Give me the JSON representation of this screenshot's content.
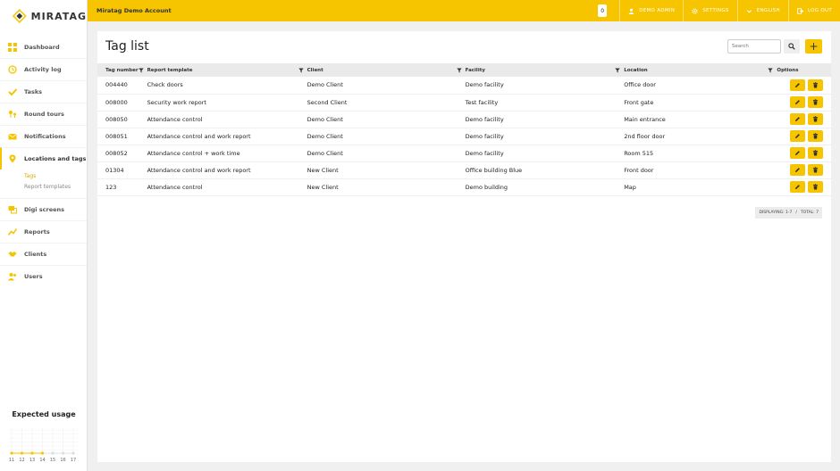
{
  "brand": {
    "name": "MIRATAG",
    "accent": "#f7c500"
  },
  "sidebar": {
    "items": [
      {
        "label": "Dashboard",
        "icon": "grid-icon"
      },
      {
        "label": "Activity log",
        "icon": "history-icon"
      },
      {
        "label": "Tasks",
        "icon": "check-icon"
      },
      {
        "label": "Round tours",
        "icon": "route-pins-icon"
      },
      {
        "label": "Notifications",
        "icon": "envelope-icon"
      },
      {
        "label": "Locations and tags",
        "icon": "pin-icon",
        "active": true
      },
      {
        "label": "Digi screens",
        "icon": "screens-icon"
      },
      {
        "label": "Reports",
        "icon": "chart-line-icon"
      },
      {
        "label": "Clients",
        "icon": "handshake-icon"
      },
      {
        "label": "Users",
        "icon": "users-icon"
      }
    ],
    "subitems": [
      {
        "label": "Tags",
        "selected": true
      },
      {
        "label": "Report templates"
      }
    ]
  },
  "usage": {
    "title": "Expected usage",
    "labels": [
      "11",
      "12",
      "13",
      "14",
      "15",
      "16",
      "17"
    ],
    "active_count": 4
  },
  "topbar": {
    "account": "Miratag Demo Account",
    "badge": "0",
    "user": "Demo admin",
    "settings": "Settings",
    "language": "English",
    "logout": "Log out"
  },
  "page": {
    "title": "Tag list",
    "search_placeholder": "Search",
    "add_label": "+"
  },
  "table": {
    "headers": [
      "Tag number",
      "Report template",
      "Client",
      "Facility",
      "Location",
      "Options"
    ],
    "rows": [
      [
        "004440",
        "Check doors",
        "Demo Client",
        "Demo facility",
        "Office door"
      ],
      [
        "008000",
        "Security work report",
        "Second Client",
        "Test facility",
        "Front gate"
      ],
      [
        "008050",
        "Attendance control",
        "Demo Client",
        "Demo facility",
        "Main entrance"
      ],
      [
        "008051",
        "Attendance control and work report",
        "Demo Client",
        "Demo facility",
        "2nd floor door"
      ],
      [
        "008052",
        "Attendance control + work time",
        "Demo Client",
        "Demo facility",
        "Room 515"
      ],
      [
        "01304",
        "Attendance control and work report",
        "New Client",
        "Office building Blue",
        "Front door"
      ],
      [
        "123",
        "Attendance control",
        "New Client",
        "Demo building",
        "Map"
      ]
    ]
  },
  "pagination": {
    "displaying": "Displaying: 1-7",
    "separator": "/",
    "total": "Total: 7"
  }
}
